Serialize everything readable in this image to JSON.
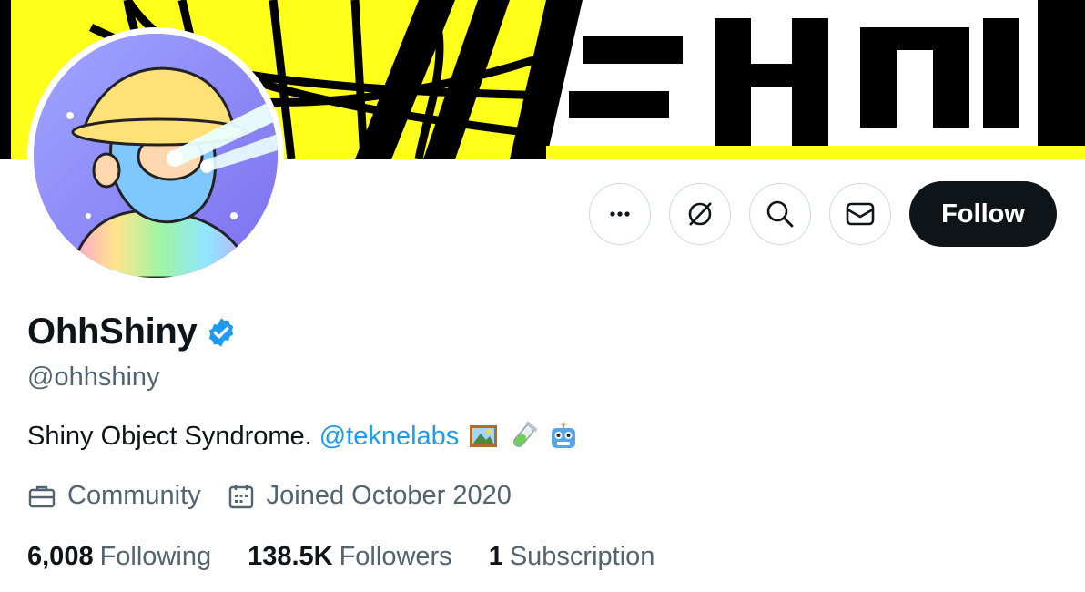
{
  "banner": {
    "text": "SHOW",
    "colors": {
      "bg": "#ffff1a",
      "ink": "#000000"
    }
  },
  "profile": {
    "display_name": "OhhShiny",
    "handle": "@ohhshiny",
    "verified": true,
    "bio": {
      "text": "Shiny Object Syndrome.",
      "mention": "@teknelabs",
      "emojis": [
        "framed-picture-emoji",
        "test-tube-emoji",
        "robot-emoji"
      ]
    },
    "meta": {
      "category": "Community",
      "joined": "Joined October 2020"
    },
    "stats": {
      "following_count": "6,008",
      "following_label": "Following",
      "followers_count": "138.5K",
      "followers_label": "Followers",
      "subscriptions_count": "1",
      "subscriptions_label": "Subscription"
    }
  },
  "actions": {
    "more_icon": "more-icon",
    "grok_icon": "grok-icon",
    "search_icon": "search-icon",
    "message_icon": "message-icon",
    "follow_label": "Follow"
  },
  "colors": {
    "accent": "#1d9bf0",
    "text_primary": "#0f1419",
    "text_secondary": "#536471",
    "button_dark": "#0f1419",
    "border": "#cfd9de"
  }
}
